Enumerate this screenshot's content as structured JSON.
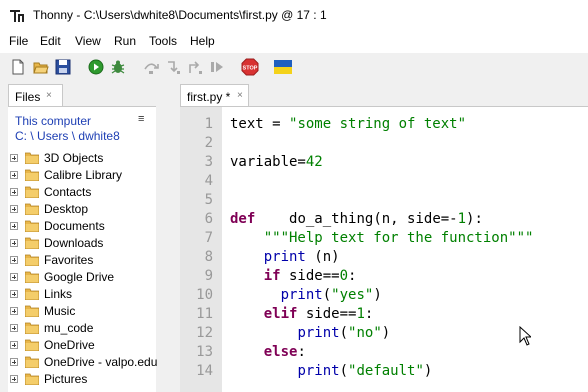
{
  "window": {
    "app_name": "Thonny",
    "title": "Thonny  -  C:\\Users\\dwhite8\\Documents\\first.py  @  17 : 1"
  },
  "menu": [
    "File",
    "Edit",
    "View",
    "Run",
    "Tools",
    "Help"
  ],
  "toolbar": {
    "icons": [
      "new-file-icon",
      "open-folder-icon",
      "save-icon",
      "run-icon",
      "debug-icon",
      "step-over-icon",
      "step-into-icon",
      "step-out-icon",
      "resume-icon",
      "stop-icon",
      "ukraine-flag-icon"
    ],
    "stop_label": "STOP"
  },
  "files_panel": {
    "tab_label": "Files",
    "close": "×",
    "location_title": "This computer",
    "path_parts": [
      "C:",
      "\\",
      "Users",
      "\\",
      "dwhite8"
    ],
    "menu_icon": "≡",
    "items": [
      "3D Objects",
      "Calibre Library",
      "Contacts",
      "Desktop",
      "Documents",
      "Downloads",
      "Favorites",
      "Google Drive",
      "Links",
      "Music",
      "mu_code",
      "OneDrive",
      "OneDrive - valpo.edu",
      "Pictures"
    ]
  },
  "editor": {
    "tab_label": "first.py *",
    "close": "×",
    "line_numbers": [
      "1",
      "2",
      "3",
      "4",
      "5",
      "6",
      "7",
      "8",
      "9",
      "10",
      "11",
      "12",
      "13",
      "14"
    ],
    "lines": {
      "l1": {
        "a": "text = ",
        "b": "\"some string of text\""
      },
      "l3": {
        "a": "variable=",
        "b": "42"
      },
      "l6": {
        "kw": "def",
        "a": "    do_a_thing",
        "b": "(n, side=-",
        "c": "1",
        "d": "):"
      },
      "l7": {
        "a": "    ",
        "b": "\"\"\"Help text for the function\"\"\""
      },
      "l8": {
        "a": "    ",
        "b": "print",
        "c": " (n)"
      },
      "l9": {
        "a": "    ",
        "kw": "if",
        "b": " side==",
        "c": "0",
        "d": ":"
      },
      "l10": {
        "a": "      ",
        "b": "print",
        "c": "(",
        "d": "\"yes\"",
        "e": ")"
      },
      "l11": {
        "a": "    ",
        "kw": "elif",
        "b": " side==",
        "c": "1",
        "d": ":"
      },
      "l12": {
        "a": "        ",
        "b": "print",
        "c": "(",
        "d": "\"no\"",
        "e": ")"
      },
      "l13": {
        "a": "    ",
        "kw": "else",
        "d": ":"
      },
      "l14": {
        "a": "        ",
        "b": "print",
        "c": "(",
        "d": "\"default\"",
        "e": ")"
      }
    }
  }
}
